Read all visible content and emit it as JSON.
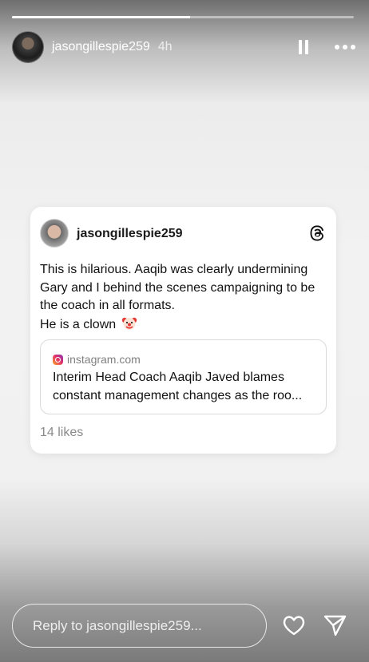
{
  "story": {
    "progress_fraction": 0.52,
    "username": "jasongillespie259",
    "time": "4h",
    "icons": {
      "pause": "pause-icon",
      "more": "more-dots-icon"
    }
  },
  "post": {
    "username": "jasongillespie259",
    "text_lines": [
      "This is hilarious. Aaqib was clearly undermining",
      "Gary and I behind the scenes campaigning to be",
      "the coach in all formats.",
      "He is a clown"
    ],
    "emoji": "🤡",
    "link": {
      "source": "instagram.com",
      "title_lines": [
        "Interim Head Coach Aaqib Javed blames",
        "constant management changes as the roo..."
      ]
    },
    "likes": "14 likes",
    "icons": {
      "app": "threads-icon"
    }
  },
  "reply": {
    "placeholder": "Reply to jasongillespie259...",
    "icons": {
      "like": "heart-icon",
      "send": "send-icon"
    }
  }
}
